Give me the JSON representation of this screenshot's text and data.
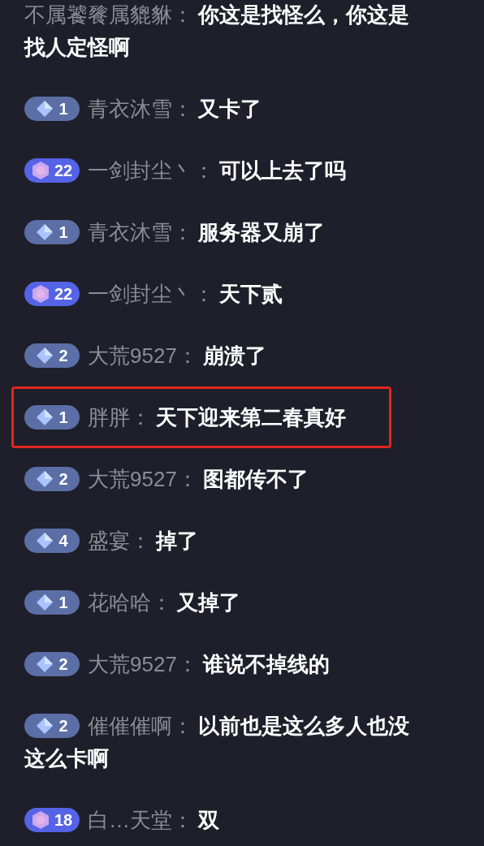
{
  "messages": [
    {
      "name": "不属饕餮属貔貅：",
      "lines": [
        "你这是找怪么，你这是",
        "找人定怪啊"
      ],
      "highlighted": false
    },
    {
      "badge": {
        "kind": "gem",
        "level": "1"
      },
      "name": "青衣沐雪：",
      "lines": [
        "又卡了"
      ],
      "highlighted": false
    },
    {
      "badge": {
        "kind": "hex",
        "level": "22"
      },
      "name": "一剑封尘丶：",
      "lines": [
        "可以上去了吗"
      ],
      "highlighted": false
    },
    {
      "badge": {
        "kind": "gem",
        "level": "1"
      },
      "name": "青衣沐雪：",
      "lines": [
        "服务器又崩了"
      ],
      "highlighted": false
    },
    {
      "badge": {
        "kind": "hex",
        "level": "22"
      },
      "name": "一剑封尘丶：",
      "lines": [
        "天下贰"
      ],
      "highlighted": false
    },
    {
      "badge": {
        "kind": "gem",
        "level": "2"
      },
      "name": "大荒9527：",
      "lines": [
        "崩溃了"
      ],
      "highlighted": false
    },
    {
      "badge": {
        "kind": "gem",
        "level": "1"
      },
      "name": "胖胖：",
      "lines": [
        "天下迎来第二春真好"
      ],
      "highlighted": true
    },
    {
      "badge": {
        "kind": "gem",
        "level": "2"
      },
      "name": "大荒9527：",
      "lines": [
        "图都传不了"
      ],
      "highlighted": false
    },
    {
      "badge": {
        "kind": "gem",
        "level": "4"
      },
      "name": "盛宴：",
      "lines": [
        "掉了"
      ],
      "highlighted": false
    },
    {
      "badge": {
        "kind": "gem",
        "level": "1"
      },
      "name": "花哈哈：",
      "lines": [
        "又掉了"
      ],
      "highlighted": false
    },
    {
      "badge": {
        "kind": "gem",
        "level": "2"
      },
      "name": "大荒9527：",
      "lines": [
        "谁说不掉线的"
      ],
      "highlighted": false
    },
    {
      "badge": {
        "kind": "gem",
        "level": "2"
      },
      "name": "催催催啊：",
      "lines": [
        "以前也是这么多人也没",
        "这么卡啊"
      ],
      "highlighted": false
    },
    {
      "badge": {
        "kind": "hex",
        "level": "18"
      },
      "name": "白…天堂：",
      "lines": [
        "双"
      ],
      "highlighted": false
    }
  ]
}
